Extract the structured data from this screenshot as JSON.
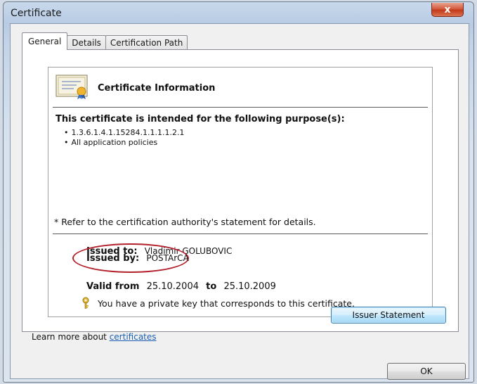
{
  "window": {
    "title": "Certificate",
    "close_label": "x"
  },
  "tabs": [
    {
      "label": "General",
      "active": true
    },
    {
      "label": "Details",
      "active": false
    },
    {
      "label": "Certification Path",
      "active": false
    }
  ],
  "general": {
    "heading": "Certificate Information",
    "purpose_heading": "This certificate is intended for the following purpose(s):",
    "purposes": [
      "1.3.6.1.4.1.15284.1.1.1.1.2.1",
      "All application policies"
    ],
    "refer_note": "* Refer to the certification authority's statement for details.",
    "issued_to_label": "Issued to:",
    "issued_to_value": "Vladimir GOLUBOVIC",
    "issued_by_label": "Issued by:",
    "issued_by_value": "POSTArCA",
    "valid_from_label": "Valid from",
    "valid_from_value": "25.10.2004",
    "valid_to_label": "to",
    "valid_to_value": "25.10.2009",
    "private_key_note": "You have a private key that corresponds to this certificate."
  },
  "buttons": {
    "issuer_statement": "Issuer Statement",
    "ok": "OK"
  },
  "learn_more": {
    "prefix": "Learn more about ",
    "link": "certificates"
  },
  "icons": {
    "certificate": "certificate-icon",
    "key": "key-icon",
    "close": "close-icon"
  },
  "colors": {
    "highlight_ellipse": "#b3202a",
    "close_button": "#c74a2c",
    "link": "#1a5fb4"
  }
}
